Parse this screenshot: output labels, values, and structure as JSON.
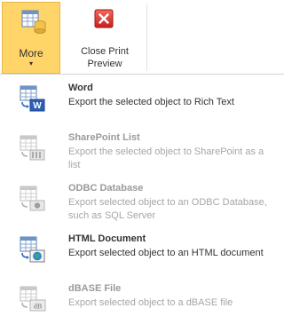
{
  "ribbon": {
    "more": {
      "label": "More",
      "chevron": "▾",
      "icon": "table-export-icon"
    },
    "close_print_preview": {
      "line1": "Close Print",
      "line2": "Preview",
      "icon": "close-red-icon"
    }
  },
  "menu": {
    "items": [
      {
        "title": "Word",
        "description": "Export the selected object to Rich Text",
        "enabled": true,
        "icon": "word-export-icon"
      },
      {
        "title": "SharePoint List",
        "description": "Export the selected object to SharePoint as a list",
        "enabled": false,
        "icon": "sharepoint-list-icon"
      },
      {
        "title": "ODBC Database",
        "description": "Export selected object to an ODBC Database, such as SQL Server",
        "enabled": false,
        "icon": "odbc-database-icon"
      },
      {
        "title": "HTML Document",
        "description": "Export selected object to an HTML document",
        "enabled": true,
        "icon": "html-document-icon"
      },
      {
        "title": "dBASE File",
        "description": "Export selected object to a dBASE file",
        "enabled": false,
        "icon": "dbase-file-icon"
      }
    ]
  },
  "colors": {
    "selected_button_fill": "#ffd56a",
    "selected_button_border": "#e8b64a",
    "disabled_text": "#a6a6a6",
    "close_icon_red": "#d9292b"
  }
}
